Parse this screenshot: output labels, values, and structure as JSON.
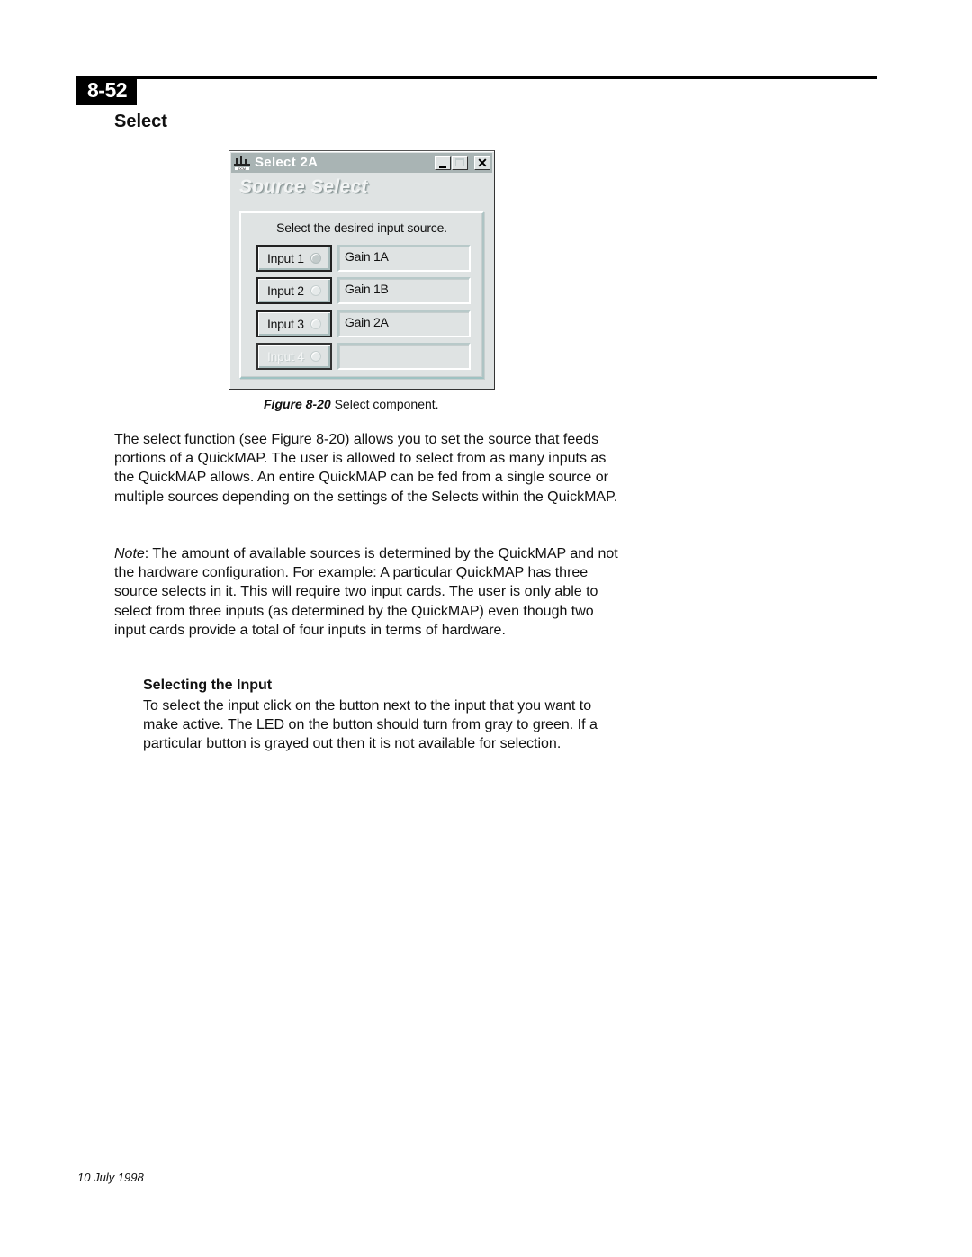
{
  "page": {
    "page_number": "8-52",
    "section_title": "Select",
    "footer_date": "10 July 1998"
  },
  "window": {
    "title": "Select 2A",
    "icon": "dcm-app-icon",
    "controls": {
      "minimize": "_",
      "maximize": "□",
      "close": "✕"
    },
    "heading": "Source Select",
    "group_label": "Select the desired input source.",
    "rows": [
      {
        "button": "Input 1",
        "field": "Gain 1A",
        "enabled": true,
        "led": "gray"
      },
      {
        "button": "Input 2",
        "field": "Gain 1B",
        "enabled": true,
        "led": "off"
      },
      {
        "button": "Input 3",
        "field": "Gain 2A",
        "enabled": true,
        "led": "off"
      },
      {
        "button": "Input 4",
        "field": "",
        "enabled": false,
        "led": "off"
      }
    ]
  },
  "figure": {
    "label": "Figure 8-20",
    "caption": " Select component."
  },
  "body": {
    "paragraph1": "The select function (see Figure 8-20) allows you to set the source that feeds portions of a QuickMAP. The user is allowed to select from as many inputs as the QuickMAP allows. An entire QuickMAP can be fed from a single source or multiple sources depending on the settings of the Selects within the QuickMAP.",
    "note_label": "Note",
    "note_text": ": The amount of available sources is determined by the QuickMAP and not the hardware configuration. For example: A particular QuickMAP has three source selects in it. This will require two input cards. The user is only able to select from three inputs (as determined by the QuickMAP) even though two input cards provide a total of four inputs in terms of hardware.",
    "subheading": "Selecting the Input",
    "paragraph3": "To select the input click on the button next to the input that you want to make active. The LED on the button should turn from gray to green. If a particular button is grayed out then it is not available for selection."
  }
}
